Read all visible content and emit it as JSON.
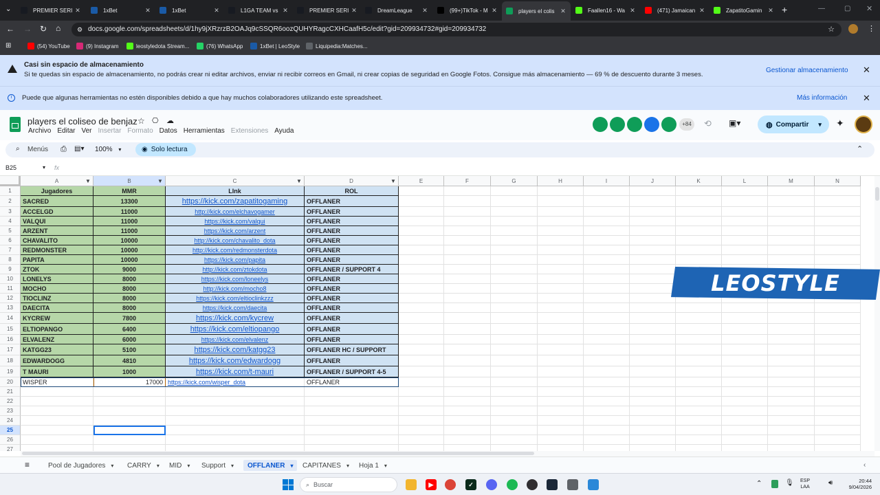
{
  "browser": {
    "tabs": [
      {
        "title": "PREMIER SERIE",
        "icon": "steam-icon",
        "color": "#171a21"
      },
      {
        "title": "1xBet",
        "icon": "1xbet-icon",
        "color": "#1a5aa6"
      },
      {
        "title": "1xBet",
        "icon": "1xbet-icon",
        "color": "#1a5aa6"
      },
      {
        "title": "L1GA TEAM vs",
        "icon": "steam-icon",
        "color": "#171a21"
      },
      {
        "title": "PREMIER SERIE",
        "icon": "steam-icon",
        "color": "#171a21"
      },
      {
        "title": "DreamLeague",
        "icon": "steam-icon",
        "color": "#171a21"
      },
      {
        "title": "(99+)TikTok - M",
        "icon": "tiktok-icon",
        "color": "#000000"
      },
      {
        "title": "players el colis",
        "icon": "sheets-icon",
        "color": "#0f9d58"
      },
      {
        "title": "Faallen16 - Wa",
        "icon": "kick-icon",
        "color": "#53fc18"
      },
      {
        "title": "(471) Jamaican",
        "icon": "youtube-icon",
        "color": "#ff0000"
      },
      {
        "title": "ZapatitoGamin",
        "icon": "kick-icon",
        "color": "#53fc18"
      }
    ],
    "url": "docs.google.com/spreadsheets/d/1hy9jXRzrzB2OAJq9cSSQR6oozQUHYRagcCXHCaafH5c/edit?gid=209934732#gid=209934732",
    "bookmarks": [
      {
        "label": "(54) YouTube",
        "icon": "youtube-icon",
        "color": "#ff0000"
      },
      {
        "label": "(9) Instagram",
        "icon": "instagram-icon",
        "color": "#d62976"
      },
      {
        "label": "leostyledota Stream...",
        "icon": "kick-icon",
        "color": "#53fc18"
      },
      {
        "label": "(76) WhatsApp",
        "icon": "whatsapp-icon",
        "color": "#25d366"
      },
      {
        "label": "1xBet | LeoStyle",
        "icon": "1xbet-icon",
        "color": "#1a5aa6"
      },
      {
        "label": "Liquipedia:Matches...",
        "icon": "liquipedia-icon",
        "color": "#5f6368"
      }
    ]
  },
  "banners": {
    "storage_title": "Casi sin espacio de almacenamiento",
    "storage_text": "Si te quedas sin espacio de almacenamiento, no podrás crear ni editar archivos, enviar ni recibir correos en Gmail, ni crear copias de seguridad en Google Fotos. Consigue más almacenamiento — 69 % de descuento durante 3 meses.",
    "storage_action": "Gestionar almacenamiento",
    "collab_text": "Puede que algunas herramientas no estén disponibles debido a que hay muchos colaboradores utilizando este spreadsheet.",
    "collab_action": "Más información"
  },
  "sheet": {
    "title": "players el coliseo de benjaz",
    "menu": [
      "Archivo",
      "Editar",
      "Ver",
      "Insertar",
      "Formato",
      "Datos",
      "Herramientas",
      "Extensiones",
      "Ayuda"
    ],
    "menu_disabled": [
      false,
      false,
      false,
      true,
      true,
      false,
      false,
      true,
      false
    ],
    "collaborator_count": "+84",
    "share_label": "Compartir",
    "menus_label": "Menús",
    "zoom": "100%",
    "readonly_label": "Solo lectura",
    "name_box": "B25",
    "fx_label": "fx"
  },
  "grid": {
    "columns": [
      "A",
      "B",
      "C",
      "D",
      "E",
      "F",
      "G",
      "H",
      "I",
      "J",
      "K",
      "L",
      "M",
      "N"
    ],
    "header": [
      "Jugadores",
      "MMR",
      "LInk",
      "ROL"
    ],
    "rows": [
      {
        "n": "2",
        "player": "SACRED",
        "mmr": "13300",
        "link": "https://kick.com/zapatitogaming",
        "rol": "OFFLANER",
        "big": true
      },
      {
        "n": "3",
        "player": "ACCELGD",
        "mmr": "11000",
        "link": "http://kick.com/elchavogamer",
        "rol": "OFFLANER",
        "big": false
      },
      {
        "n": "4",
        "player": "VALQUI",
        "mmr": "11000",
        "link": "https://kick.com/valqui",
        "rol": "OFFLANER",
        "big": false
      },
      {
        "n": "5",
        "player": "ARZENT",
        "mmr": "11000",
        "link": "https://kick.com/arzent",
        "rol": "OFFLANER",
        "big": false
      },
      {
        "n": "6",
        "player": "CHAVALITO",
        "mmr": "10000",
        "link": "http://kick.com/chavalito_dota",
        "rol": "OFFLANER",
        "big": false
      },
      {
        "n": "7",
        "player": "REDMONSTER",
        "mmr": "10000",
        "link": "http://kick.com/redmonsterdota",
        "rol": "OFFLANER",
        "big": false
      },
      {
        "n": "8",
        "player": "PAPITA",
        "mmr": "10000",
        "link": "https://kick.com/papita",
        "rol": "OFFLANER",
        "big": false
      },
      {
        "n": "9",
        "player": "ZTOK",
        "mmr": "9000",
        "link": "http://kick.com/ztokdota",
        "rol": "OFFLANER / SUPPORT 4",
        "big": false
      },
      {
        "n": "10",
        "player": "LONELYS",
        "mmr": "8000",
        "link": "https://kick.com/loneelys",
        "rol": "OFFLANER",
        "big": false
      },
      {
        "n": "11",
        "player": "MOCHO",
        "mmr": "8000",
        "link": "http://kick.com/mocho8",
        "rol": "OFFLANER",
        "big": false
      },
      {
        "n": "12",
        "player": "TIOCLINZ",
        "mmr": "8000",
        "link": "https://kick.com/eltioclinkzzz",
        "rol": "OFFLANER",
        "big": false
      },
      {
        "n": "13",
        "player": "DAECITA",
        "mmr": "8000",
        "link": "https://kick.com/daecita",
        "rol": "OFFLANER",
        "big": false
      },
      {
        "n": "14",
        "player": "KYCREW",
        "mmr": "7800",
        "link": "https://kick.com/kycrew",
        "rol": "OFFLANER",
        "big": true
      },
      {
        "n": "15",
        "player": "ELTIOPANGO",
        "mmr": "6400",
        "link": "https://kick.com/eltiopango",
        "rol": "OFFLANER",
        "big": true
      },
      {
        "n": "16",
        "player": "ELVALENZ",
        "mmr": "6000",
        "link": "https://kick.com/elvalenz",
        "rol": "OFFLANER",
        "big": false
      },
      {
        "n": "17",
        "player": "KATGG23",
        "mmr": "5100",
        "link": "https://kick.com/katgg23",
        "rol": "OFFLANER HC / SUPPORT",
        "big": true
      },
      {
        "n": "18",
        "player": "EDWARDOGG",
        "mmr": "4810",
        "link": "https://kick.com/edwardogg",
        "rol": "OFFLANER",
        "big": true
      },
      {
        "n": "19",
        "player": "T MAURI",
        "mmr": "1000",
        "link": "https://kick.com/t-mauri",
        "rol": "OFFLANER / SUPPORT 4-5",
        "big": true
      }
    ],
    "row20": {
      "n": "20",
      "player": "WISPER",
      "mmr": "17000",
      "link": "https://kick.com/wisper_dota",
      "rol": "OFFLANER"
    },
    "empty_rows": [
      "21",
      "22",
      "23",
      "24",
      "25",
      "26",
      "27"
    ],
    "selected_row": "25",
    "header_row_num": "1"
  },
  "overlay": {
    "watermark": "LEOSTYLE"
  },
  "sheet_tabs": [
    "Pool de Jugadores",
    "CARRY",
    "MID",
    "Support",
    "OFFLANER",
    "CAPITANES",
    "Hoja 1"
  ],
  "active_sheet_tab": "OFFLANER",
  "taskbar": {
    "search_placeholder": "Buscar",
    "lang": "ESP",
    "lang2": "LAA",
    "time": "20:44",
    "date": "9/04/2026"
  },
  "colors": {
    "header_green": "#b6d7a8",
    "mmr_green": "#b6d7a8",
    "link_blue": "#cfe2f3",
    "rol_blue": "#cfe2f3",
    "accent_blue": "#0b57d0",
    "banner_bg": "#d3e3fd"
  }
}
